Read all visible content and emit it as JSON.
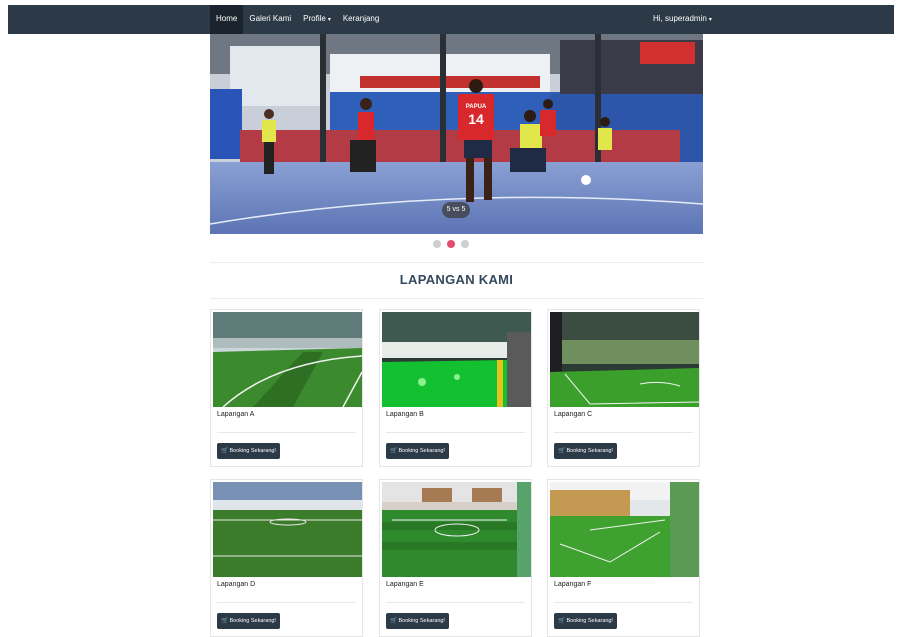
{
  "navbar": {
    "items": [
      {
        "label": "Home",
        "active": true
      },
      {
        "label": "Galeri Kami",
        "active": false
      },
      {
        "label": "Profile",
        "active": false,
        "dropdown": true
      },
      {
        "label": "Keranjang",
        "active": false
      }
    ],
    "user_label": "Hi, superadmin",
    "caret_icon": "chevron-down-icon"
  },
  "carousel": {
    "caption": "5 vs 5",
    "slide_count": 3,
    "active_slide": 2,
    "jersey_text": "PAPUA",
    "jersey_number": "14"
  },
  "section": {
    "title": "LAPANGAN KAMI"
  },
  "booking_button": {
    "label": "Booking Sekarang!",
    "icon": "cart-icon"
  },
  "courts": [
    {
      "name": "Lapangan A"
    },
    {
      "name": "Lapangan B"
    },
    {
      "name": "Lapangan C"
    },
    {
      "name": "Lapangan D"
    },
    {
      "name": "Lapangan E"
    },
    {
      "name": "Lapangan F"
    }
  ],
  "colors": {
    "navbar": "#2c3947",
    "accent": "#e44d72",
    "button": "#2c3947"
  }
}
